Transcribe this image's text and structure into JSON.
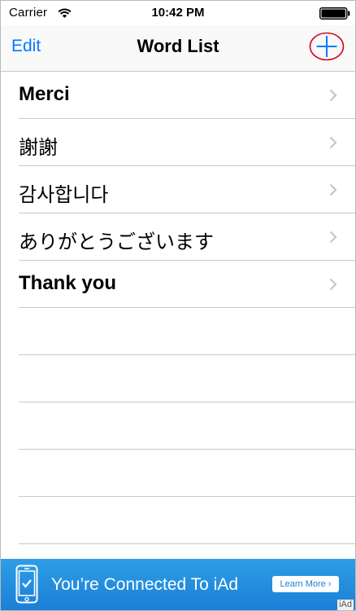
{
  "status_bar": {
    "carrier": "Carrier",
    "time": "10:42 PM",
    "icons": [
      "wifi-icon",
      "battery-icon"
    ]
  },
  "nav": {
    "edit_label": "Edit",
    "title": "Word List",
    "add_icon": "plus-icon",
    "accent_color": "#007aff",
    "highlight_color": "#d0021b"
  },
  "words": [
    {
      "label": "Merci"
    },
    {
      "label": "謝謝"
    },
    {
      "label": "감사합니다"
    },
    {
      "label": "ありがとうございます"
    },
    {
      "label": "Thank you"
    }
  ],
  "ad": {
    "text": "You’re Connected To iAd",
    "button_label": "Learn More ›",
    "logo_text": "iAd",
    "color": "#1b7fd6"
  }
}
